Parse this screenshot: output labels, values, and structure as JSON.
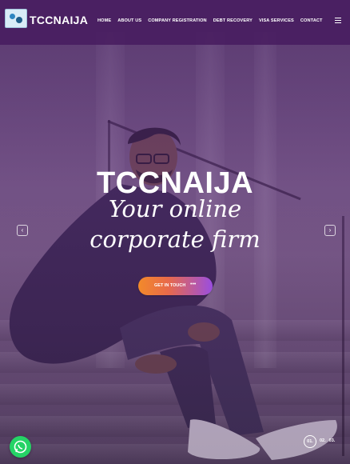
{
  "brand": {
    "name": "TCCNAIJA"
  },
  "nav": {
    "items": [
      "HOME",
      "ABOUT US",
      "COMPANY REGISTRATION",
      "DEBT RECOVERY",
      "VISA SERVICES",
      "CONTACT"
    ]
  },
  "hero": {
    "headline": "TCCNAIJA",
    "tagline_line1": "Your online",
    "tagline_line2": "corporate firm",
    "cta_label": "GET IN TOUCH",
    "cta_dots": "•••"
  },
  "slider": {
    "prev_icon": "chevron-left-icon",
    "next_icon": "chevron-right-icon",
    "pages": [
      "01.",
      "02.",
      "03."
    ],
    "active_page": "01."
  },
  "widgets": {
    "whatsapp_icon": "whatsapp-icon"
  },
  "colors": {
    "nav_bg": "#481c60",
    "overlay": "#58287a",
    "cta_start": "#f28a2a",
    "cta_end": "#9a4ee0",
    "whatsapp": "#25d366"
  }
}
